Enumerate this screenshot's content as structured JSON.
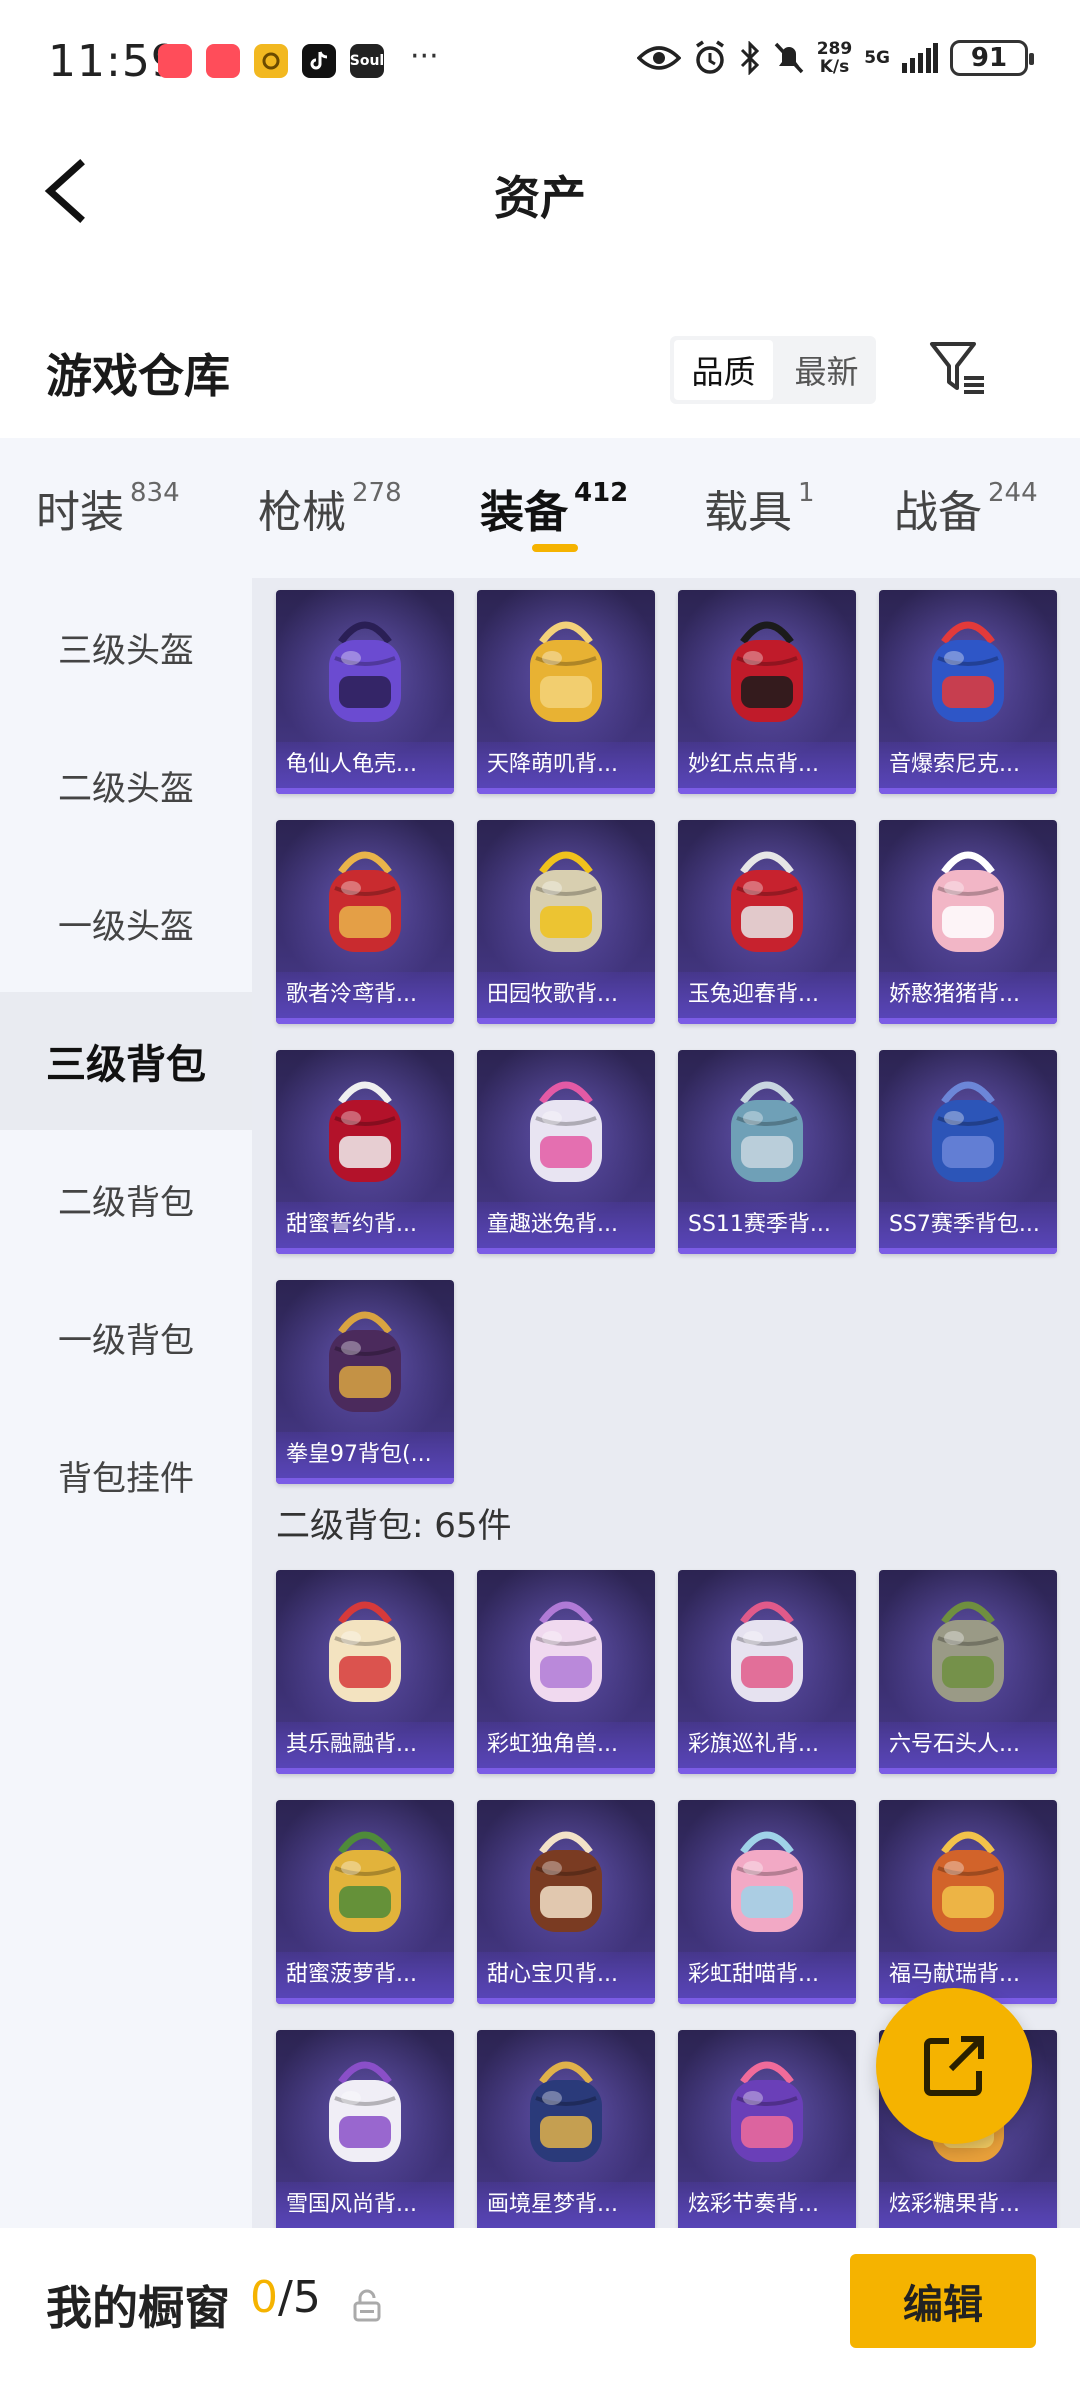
{
  "status_bar": {
    "time": "11:59",
    "net_speed_value": "289",
    "net_speed_unit": "K/s",
    "network": "5G",
    "battery": "91",
    "app_icons": [
      {
        "icon": "red-bag-app-icon",
        "color": "#ff4d5a",
        "text": ""
      },
      {
        "icon": "red-bag-app-icon",
        "color": "#ff4d5a",
        "text": ""
      },
      {
        "icon": "ring-app-icon",
        "color": "#f2b820",
        "text": ""
      },
      {
        "icon": "tiktok-app-icon",
        "color": "#111111",
        "text": ""
      },
      {
        "icon": "soul-app-icon",
        "color": "#222222",
        "text": "Soul"
      }
    ],
    "more": "···"
  },
  "nav": {
    "title": "资产"
  },
  "header": {
    "warehouse_title": "游戏仓库",
    "sort_options": [
      "品质",
      "最新"
    ],
    "sort_selected": "品质"
  },
  "category_tabs": [
    {
      "label": "时装",
      "count": "834"
    },
    {
      "label": "枪械",
      "count": "278"
    },
    {
      "label": "装备",
      "count": "412",
      "active": true
    },
    {
      "label": "载具",
      "count": "1"
    },
    {
      "label": "战备",
      "count": "244"
    }
  ],
  "sidebar": [
    {
      "label": "三级头盔"
    },
    {
      "label": "二级头盔"
    },
    {
      "label": "一级头盔"
    },
    {
      "label": "三级背包",
      "active": true
    },
    {
      "label": "二级背包"
    },
    {
      "label": "一级背包"
    },
    {
      "label": "背包挂件"
    }
  ],
  "level3_items": [
    {
      "name": "龟仙人龟壳...",
      "color": "#6b4bd1",
      "accent": "#2a1f55"
    },
    {
      "name": "天降萌叽背...",
      "color": "#e8b233",
      "accent": "#f3d27a"
    },
    {
      "name": "妙红点点背...",
      "color": "#c01b2a",
      "accent": "#1b1b1b"
    },
    {
      "name": "音爆索尼克...",
      "color": "#2e56c7",
      "accent": "#e23a3a"
    },
    {
      "name": "歌者泠鸢背...",
      "color": "#c92b2f",
      "accent": "#e9b44a"
    },
    {
      "name": "田园牧歌背...",
      "color": "#d8cfb0",
      "accent": "#f0c21c"
    },
    {
      "name": "玉兔迎春背...",
      "color": "#c7222e",
      "accent": "#e6e6e6"
    },
    {
      "name": "娇憨猪猪背...",
      "color": "#f2b6c6",
      "accent": "#ffffff"
    },
    {
      "name": "甜蜜誓约背...",
      "color": "#b3122a",
      "accent": "#f0f0f0"
    },
    {
      "name": "童趣迷兔背...",
      "color": "#e8e4f2",
      "accent": "#e35aa5"
    },
    {
      "name": "SS11赛季背...",
      "color": "#6fa0b7",
      "accent": "#c8d6e0"
    },
    {
      "name": "SS7赛季背包...",
      "color": "#2c55b8",
      "accent": "#6c86d8"
    },
    {
      "name": "拳皇97背包(...",
      "color": "#4b2a5c",
      "accent": "#d9a441"
    }
  ],
  "level2_section": "二级背包: 65件",
  "level2_items": [
    {
      "name": "其乐融融背...",
      "color": "#f3e3c0",
      "accent": "#d63a3a"
    },
    {
      "name": "彩虹独角兽...",
      "color": "#f0d9ef",
      "accent": "#b07ad6"
    },
    {
      "name": "彩旗巡礼背...",
      "color": "#e6e2f0",
      "accent": "#e05a8a"
    },
    {
      "name": "六号石头人...",
      "color": "#9a9a86",
      "accent": "#6f8f3f"
    },
    {
      "name": "甜蜜菠萝背...",
      "color": "#e2b33b",
      "accent": "#4f8b3a"
    },
    {
      "name": "甜心宝贝背...",
      "color": "#7a3b22",
      "accent": "#f3e2c8"
    },
    {
      "name": "彩虹甜喵背...",
      "color": "#f2a9c5",
      "accent": "#9fd3e8"
    },
    {
      "name": "福马献瑞背...",
      "color": "#d2632a",
      "accent": "#f2c24a"
    },
    {
      "name": "雪国风尚背...",
      "color": "#f0eef6",
      "accent": "#8a4fc8"
    },
    {
      "name": "画境星梦背...",
      "color": "#2a3a7a",
      "accent": "#e0b14a"
    },
    {
      "name": "炫彩节奏背...",
      "color": "#6a3fb8",
      "accent": "#f06b9a"
    },
    {
      "name": "炫彩糖果背...",
      "color": "#e8a03a",
      "accent": "#f4d36b"
    }
  ],
  "bottom": {
    "window_label": "我的橱窗",
    "current": "0",
    "total": "/5",
    "edit_label": "编辑"
  },
  "colors": {
    "accent": "#f5b300",
    "card_bg": "#3a2f70"
  }
}
